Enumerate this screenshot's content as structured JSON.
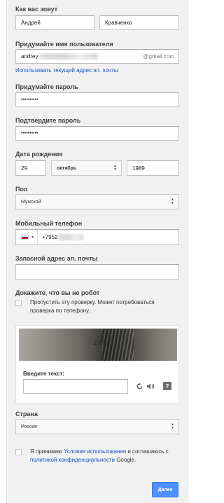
{
  "name": {
    "label": "Как вас зовут",
    "first_name": "Андрей",
    "last_name": "Кравченко"
  },
  "username": {
    "label": "Придумайте имя пользователя",
    "value": "andrey",
    "suffix": "@gmail.com",
    "use_current_link": "Использовать текущий адрес эл. почты"
  },
  "password": {
    "label": "Придумайте пароль",
    "value": "••••••••••"
  },
  "confirm_password": {
    "label": "Подтвердите пароль",
    "value": "••••••••••"
  },
  "birthdate": {
    "label": "Дата рождения",
    "day": "29",
    "month": "октябрь",
    "year": "1989"
  },
  "gender": {
    "label": "Пол",
    "value": "Мужской"
  },
  "phone": {
    "label": "Мобильный телефон",
    "country_code": "+7952",
    "flag_colors": [
      "#ffffff",
      "#1c3fa6",
      "#d52b1e"
    ]
  },
  "backup_email": {
    "label": "Запасной адрес эл. почты",
    "value": ""
  },
  "robot": {
    "label": "Докажите, что вы не робот",
    "skip_text": "Пропустить эту проверку. Может потребоваться проверка по телефону.",
    "captcha_word": "238",
    "enter_text_label": "Введите текст:",
    "input_value": "",
    "icons": [
      "refresh-icon",
      "audio-icon",
      "help-icon"
    ]
  },
  "country": {
    "label": "Страна",
    "value": "Россия"
  },
  "terms": {
    "prefix": "Я принимаю ",
    "terms_link": "Условия использования",
    "middle": " и соглашаюсь с ",
    "privacy_link": "политикой конфиденциальности",
    "suffix": " Google."
  },
  "next_button": "Далее",
  "colors": {
    "panel_bg": "#f1f1f1",
    "link": "#1155cc",
    "primary_button": "#4d90fe"
  }
}
